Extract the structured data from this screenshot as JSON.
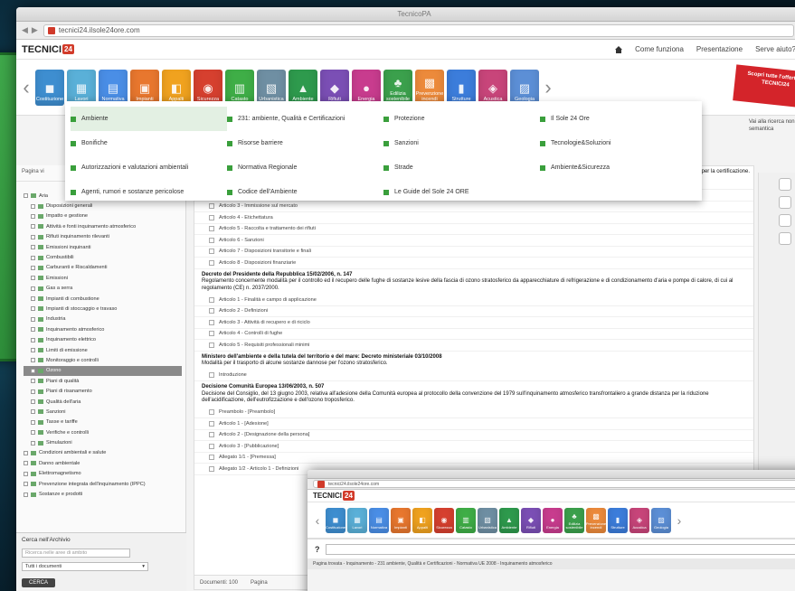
{
  "window": {
    "title": "TecnicoPA"
  },
  "browser": {
    "url": "tecnici24.ilsole24ore.com"
  },
  "site": {
    "logo_text": "TECNICI",
    "logo_badge": "24",
    "links": [
      "Come funziona",
      "Presentazione",
      "Serve aiuto?"
    ]
  },
  "ribbon": [
    {
      "label": "Costituzione",
      "color": "#3e8ed0"
    },
    {
      "label": "Lavori",
      "color": "#5ab0d8"
    },
    {
      "label": "Normativa",
      "color": "#4a8ee6"
    },
    {
      "label": "Impianti",
      "color": "#e8772e"
    },
    {
      "label": "Appalti",
      "color": "#f0a21f"
    },
    {
      "label": "Sicurezza",
      "color": "#d6402f"
    },
    {
      "label": "Catasto",
      "color": "#3fae47"
    },
    {
      "label": "Urbanistica",
      "color": "#6f8fa3"
    },
    {
      "label": "Ambiente",
      "color": "#2e9a4d"
    },
    {
      "label": "Rifiuti",
      "color": "#7b4fb5"
    },
    {
      "label": "Energia",
      "color": "#c83c8e"
    },
    {
      "label": "Edilizia sostenibile",
      "color": "#3ba04c"
    },
    {
      "label": "Prevenzione incendi",
      "color": "#ec8a3b"
    },
    {
      "label": "Strutture",
      "color": "#3c7ddb"
    },
    {
      "label": "Acustica",
      "color": "#c8457a"
    },
    {
      "label": "Geologia",
      "color": "#5c8fd6"
    }
  ],
  "promo": {
    "text": "Scopri tutte l'offerta di TECNICI24"
  },
  "side_help": "Vai alla ricerca non semantica",
  "menu": [
    [
      "Ambiente",
      "Bonifiche",
      "Autorizzazioni e valutazioni ambientali",
      "Agenti, rumori e sostanze pericolose"
    ],
    [
      "231: ambiente, Qualità e Certificazioni",
      "Risorse barriere",
      "Normativa Regionale",
      "Codice dell'Ambiente"
    ],
    [
      "Protezione",
      "Sanzioni",
      "Strade",
      "Le Guide del Sole 24 ORE"
    ],
    [
      "Il Sole 24 Ore",
      "Tecnologie&Soluzioni",
      "Ambiente&Sicurezza"
    ]
  ],
  "left_panel": {
    "top_label": "Pagina vi",
    "sub_label": "Ambiente",
    "tree": [
      {
        "label": "Aria",
        "sel": false
      },
      {
        "label": "Disposizioni generali",
        "sel": false
      },
      {
        "label": "Impatto e gestione",
        "sel": false
      },
      {
        "label": "Attività e fonti inquinamento atmosferico",
        "sel": false
      },
      {
        "label": "Rifiuti inquinamento rilevanti",
        "sel": false
      },
      {
        "label": "Emissioni inquinanti",
        "sel": false
      },
      {
        "label": "Combustibili",
        "sel": false
      },
      {
        "label": "Carburanti e Riscaldamenti",
        "sel": false
      },
      {
        "label": "Emissioni",
        "sel": false
      },
      {
        "label": "Gas a serra",
        "sel": false
      },
      {
        "label": "Impianti di combustione",
        "sel": false
      },
      {
        "label": "Impianti di stoccaggio e travaso",
        "sel": false
      },
      {
        "label": "Industria",
        "sel": false
      },
      {
        "label": "Inquinamento atmosferico",
        "sel": false
      },
      {
        "label": "Inquinamento elettrico",
        "sel": false
      },
      {
        "label": "Limiti di emissione",
        "sel": false
      },
      {
        "label": "Monitoraggio e controlli",
        "sel": false
      },
      {
        "label": "Ozono",
        "sel": true
      },
      {
        "label": "Piani di qualità",
        "sel": false
      },
      {
        "label": "Piani di risanamento",
        "sel": false
      },
      {
        "label": "Qualità dell'aria",
        "sel": false
      },
      {
        "label": "Sanzioni",
        "sel": false
      },
      {
        "label": "Tasse e tariffe",
        "sel": false
      },
      {
        "label": "Verifiche e controlli",
        "sel": false
      },
      {
        "label": "Simulazioni",
        "sel": false
      },
      {
        "label": "Condizioni ambientali e salute",
        "sel": false
      },
      {
        "label": "Danno ambientale",
        "sel": false
      },
      {
        "label": "Elettromagnetismo",
        "sel": false
      },
      {
        "label": "Prevenzione integrata dell'inquinamento (IPPC)",
        "sel": false
      },
      {
        "label": "Sostanze e prodotti",
        "sel": false
      }
    ],
    "search": {
      "header": "Cerca nell'Archivio",
      "placeholder": "Ricerca nelle aree di ambito",
      "select": "Tutti i documenti",
      "button": "CERCA"
    }
  },
  "main": {
    "intro": "prodotti per la certificazione.",
    "group1": [
      "Articolo 1 - Campo di applicazione e finalità",
      "Articolo 2 - Definizioni",
      "Articolo 3 - Immissione sul mercato",
      "Articolo 4 - Etichettatura",
      "Articolo 5 - Raccolta e trattamento dei rifiuti",
      "Articolo 6 - Sanzioni",
      "Articolo 7 - Disposizioni transitorie e finali",
      "Articolo 8 - Disposizioni finanziarie"
    ],
    "head2": "Decreto del Presidente della Repubblica 15/02/2006, n. 147",
    "head2_sub": "Regolamento concernente modalità per il controllo ed il recupero delle fughe di sostanze lesive della fascia di ozono stratosferico da apparecchiature di refrigerazione e di condizionamento d'aria e pompe di calore, di cui al regolamento (CE) n. 2037/2000.",
    "group2": [
      "Articolo 1 - Finalità e campo di applicazione",
      "Articolo 2 - Definizioni",
      "Articolo 3 - Attività di recupero e di riciclo",
      "Articolo 4 - Controlli di fughe",
      "Articolo 5 - Requisiti professionali minimi"
    ],
    "head3": "Ministero dell'ambiente e della tutela del territorio e del mare: Decreto ministeriale 03/10/2008",
    "head3_sub": "Modalità per il trasporto di alcune sostanze dannose per l'ozono stratosferico.",
    "group3": [
      "Introduzione"
    ],
    "head4": "Decisione Comunità Europea 13/06/2003, n. 507",
    "head4_sub": "Decisione del Consiglio, del 13 giugno 2003, relativa all'adesione della Comunità europea al protocollo della convenzione del 1979 sull'inquinamento atmosferico transfrontaliero a grande distanza per la riduzione dell'acidificazione, dell'eutrofizzazione e dell'ozono troposferico.",
    "group4": [
      "Preambolo - [Preambolo]",
      "Articolo 1 - [Adesione]",
      "Articolo 2 - [Designazione della persona]",
      "Articolo 3 - [Pubblicazione]",
      "Allegato 1/1 - [Premessa]",
      "Allegato 1/2 - Articolo 1 - Definizioni"
    ],
    "footer": [
      "Documenti: 100",
      "Pagina"
    ]
  },
  "second_window": {
    "logo_text": "TECNICI",
    "logo_badge": "24",
    "crumbs": "Pagina trovata - Inquinamento - 231 ambiente, Qualità e Certificazioni - Normativa UE 2008 - Inquinamento atmosferico"
  }
}
